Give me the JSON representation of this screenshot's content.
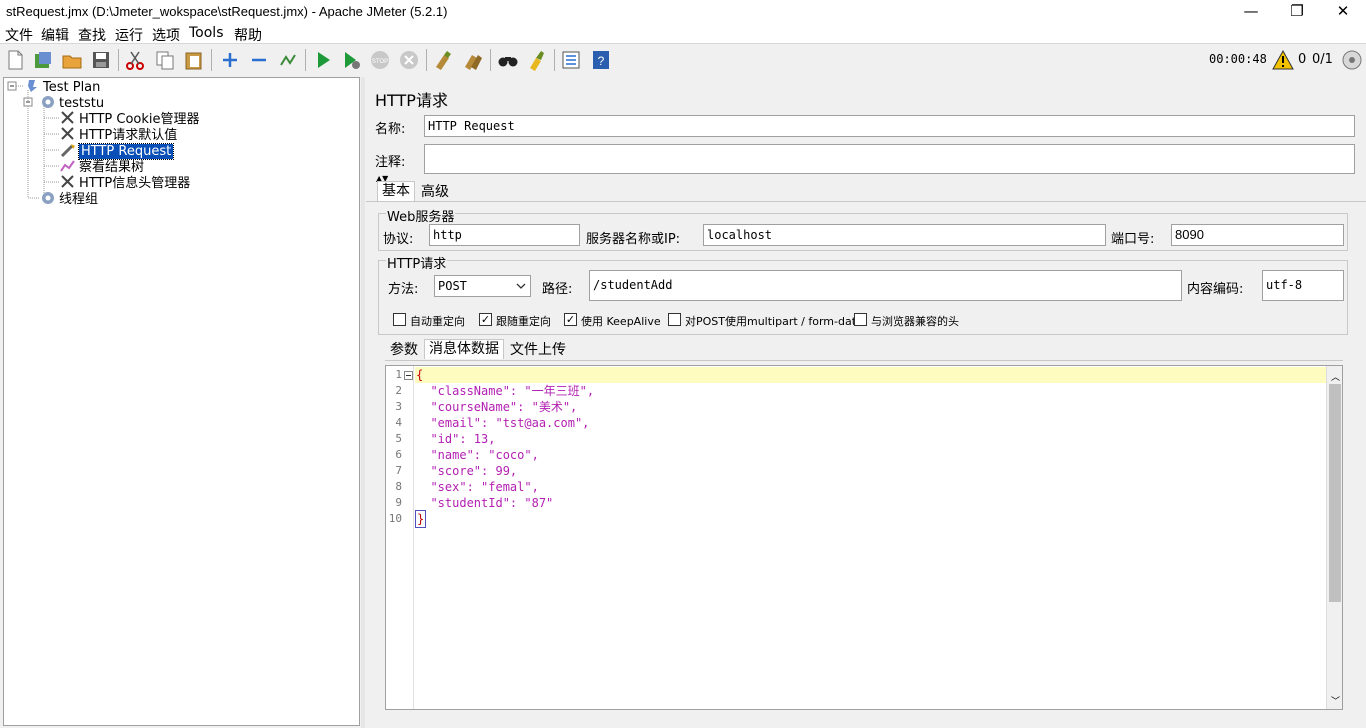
{
  "window": {
    "title": "stRequest.jmx (D:\\Jmeter_wokspace\\stRequest.jmx) - Apache JMeter (5.2.1)",
    "min": "—",
    "max": "❐",
    "close": "✕"
  },
  "menu": [
    "文件",
    "编辑",
    "查找",
    "运行",
    "选项",
    "Tools",
    "帮助"
  ],
  "toolbar": {
    "timer": "00:00:48",
    "warn_count": "0",
    "threads": "0/1"
  },
  "tree": {
    "items": [
      {
        "label": "Test Plan",
        "icon": "test-plan-icon"
      },
      {
        "label": "teststu",
        "icon": "thread-group-icon"
      },
      {
        "label": "HTTP Cookie管理器",
        "icon": "config-icon"
      },
      {
        "label": "HTTP请求默认值",
        "icon": "config-icon"
      },
      {
        "label": "HTTP Request",
        "icon": "sampler-icon"
      },
      {
        "label": "察看结果树",
        "icon": "listener-icon"
      },
      {
        "label": "HTTP信息头管理器",
        "icon": "config-icon"
      },
      {
        "label": "线程组",
        "icon": "thread-group-icon"
      }
    ]
  },
  "panel": {
    "title": "HTTP请求",
    "name_label": "名称:",
    "name_value": "HTTP Request",
    "comment_label": "注释:",
    "comment_value": "",
    "tabs": [
      "基本",
      "高级"
    ],
    "web_server_group": "Web服务器",
    "protocol_label": "协议:",
    "protocol_value": "http",
    "server_label": "服务器名称或IP:",
    "server_value": "localhost",
    "port_label": "端口号:",
    "port_value": "8090",
    "http_group": "HTTP请求",
    "method_label": "方法:",
    "method_value": "POST",
    "path_label": "路径:",
    "path_value": "/studentAdd",
    "encoding_label": "内容编码:",
    "encoding_value": "utf-8",
    "checkboxes": [
      {
        "label": "自动重定向",
        "checked": false
      },
      {
        "label": "跟随重定向",
        "checked": true
      },
      {
        "label": "使用 KeepAlive",
        "checked": true
      },
      {
        "label": "对POST使用multipart / form-data",
        "checked": false
      },
      {
        "label": "与浏览器兼容的头",
        "checked": false
      }
    ],
    "subtabs": [
      "参数",
      "消息体数据",
      "文件上传"
    ],
    "body_lines": [
      "{",
      "  \"className\": \"一年三班\",",
      "  \"courseName\": \"美术\",",
      "  \"email\": \"tst@aa.com\",",
      "  \"id\": 13,",
      "  \"name\": \"coco\",",
      "  \"score\": 99,",
      "  \"sex\": \"femal\",",
      "  \"studentId\": \"87\"",
      "}"
    ]
  }
}
